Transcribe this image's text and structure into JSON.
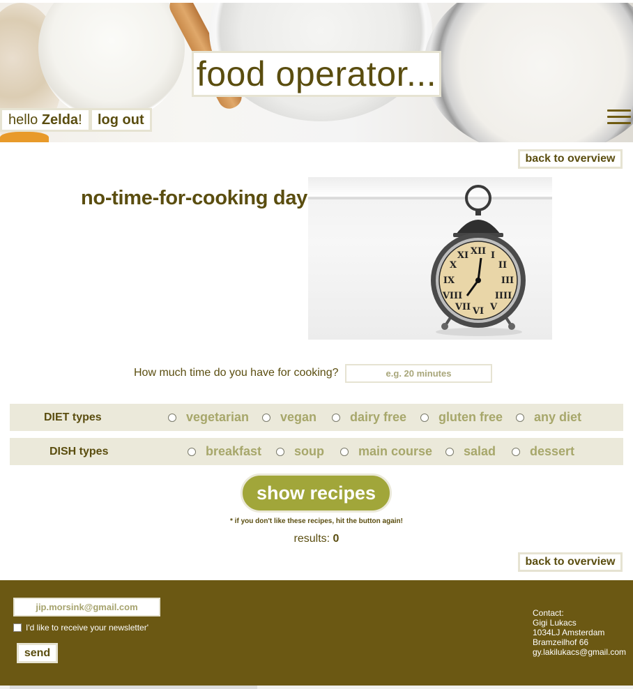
{
  "header": {
    "title": "food operator...",
    "hello_prefix": "hello ",
    "user_name": "Zelda",
    "hello_suffix": "!",
    "logout_label": "log out"
  },
  "nav": {
    "back_label_top": "back to overview",
    "back_label_bottom": "back to overview"
  },
  "main": {
    "heading": "no-time-for-cooking day",
    "time_question": "How much time do you have for cooking?",
    "time_placeholder": "e.g. 20 minutes",
    "diet": {
      "label": "DIET types",
      "options": [
        "vegetarian",
        "vegan",
        "dairy free",
        "gluten free",
        "any diet"
      ]
    },
    "dish": {
      "label": "DISH types",
      "options": [
        "breakfast",
        "soup",
        "main course",
        "salad",
        "dessert"
      ]
    },
    "show_button": "show recipes",
    "hint": "* if you don't like these recipes, hit the button again!",
    "results_label": "results: ",
    "results_count": "0"
  },
  "footer": {
    "email_value": "jip.morsink@gmail.com",
    "newsletter_label": "I'd like to receive your newsletter'",
    "send_label": "send",
    "contact": {
      "heading": "Contact:",
      "name": "Gigi Lukacs",
      "postcode_city": "1034LJ Amsterdam",
      "street": "Bramzeilhof 66",
      "email": "gy.lakilukacs@gmail.com"
    }
  },
  "colors": {
    "brand_dark": "#5a4d0f",
    "footer_bg": "#6b5813",
    "accent_green": "#a1a63a",
    "row_bg": "#ebe9da",
    "option_text": "#a7a76b"
  },
  "icons": {
    "menu": "hamburger-menu-icon",
    "clock": "alarm-clock-icon"
  }
}
